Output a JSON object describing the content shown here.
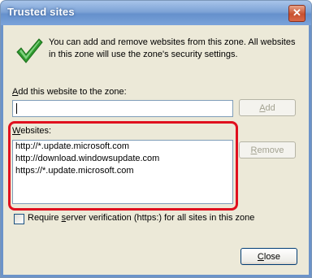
{
  "window": {
    "title": "Trusted sites",
    "close_glyph": "✕"
  },
  "info": {
    "icon": "green-checkmark-icon",
    "text": "You can add and remove websites from this zone. All websites in this zone will use the zone's security settings."
  },
  "add": {
    "label_key": "A",
    "label_rest": "dd this website to the zone:",
    "input_value": "",
    "button_key": "A",
    "button_rest": "dd"
  },
  "websites": {
    "label_key": "W",
    "label_rest": "ebsites:",
    "items": [
      "http://*.update.microsoft.com",
      "http://download.windowsupdate.com",
      "https://*.update.microsoft.com"
    ],
    "remove_key": "R",
    "remove_rest": "emove"
  },
  "require": {
    "pre": "Require ",
    "key": "s",
    "post": "erver verification (https:) for all sites in this zone",
    "checked": false
  },
  "close_button": {
    "key": "C",
    "rest": "lose"
  },
  "colors": {
    "highlight": "#e0101e",
    "title_bar": "#7ea3d6",
    "dialog_bg": "#ece9d8"
  }
}
